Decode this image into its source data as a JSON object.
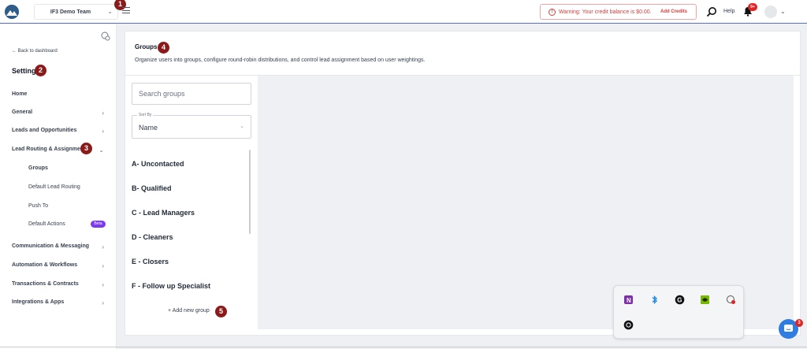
{
  "colors": {
    "brand": "#2f5d8a",
    "accent_border": "#5b6fc9",
    "warning": "#d63b3b",
    "marker": "#8b1a1a",
    "beta_badge": "#7c3aed",
    "chat": "#2f7de1"
  },
  "topbar": {
    "team_name": "IF3 Demo Team",
    "warning_text": "Warning: Your credit balance is $0.00.",
    "add_credits": "Add Credits",
    "help": "Help",
    "notification_count": "9+"
  },
  "markers": [
    "1",
    "2",
    "3",
    "4",
    "5"
  ],
  "sidebar": {
    "back": "Back to dashboard",
    "title": "Settings",
    "items": [
      {
        "label": "Home"
      },
      {
        "label": "General"
      },
      {
        "label": "Leads and Opportunities"
      },
      {
        "label": "Lead Routing & Assignment"
      },
      {
        "label": "Communication & Messaging"
      },
      {
        "label": "Automation & Workflows"
      },
      {
        "label": "Transactions & Contracts"
      },
      {
        "label": "Integrations & Apps"
      }
    ],
    "subitems": [
      {
        "label": "Groups"
      },
      {
        "label": "Default Lead Routing"
      },
      {
        "label": "Push To"
      },
      {
        "label": "Default Actions"
      }
    ],
    "beta_label": "Beta"
  },
  "main": {
    "title": "Groups",
    "description": "Organize users into groups, configure round-robin distributions, and control lead assignment based on user weightings.",
    "search_placeholder": "Search groups",
    "sort_caption": "Sort By",
    "sort_value": "Name",
    "groups": [
      "A- Uncontacted",
      "B- Qualified",
      "C - Lead Managers",
      "D - Cleaners",
      "E - Closers",
      "F - Follow up Specialist"
    ],
    "add_group": "Add new group"
  },
  "tray": {
    "icons": [
      "onenote-icon",
      "bluetooth-icon",
      "grammarly-icon",
      "nvidia-icon",
      "network-icon",
      "chatgpt-icon"
    ]
  },
  "chat": {
    "badge": "3"
  }
}
